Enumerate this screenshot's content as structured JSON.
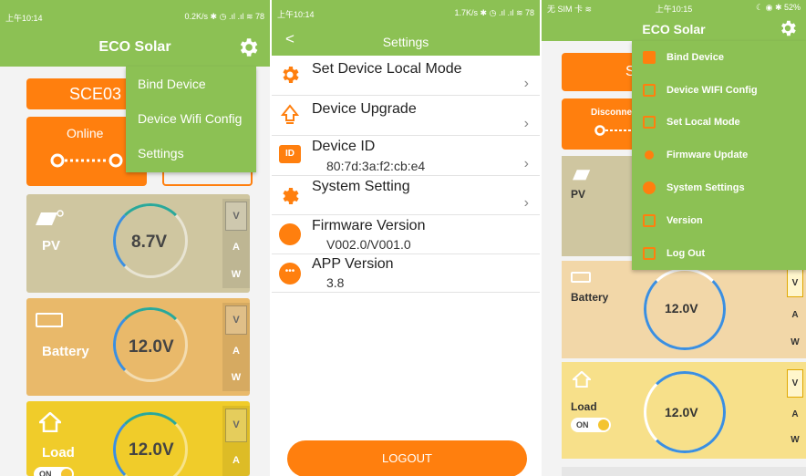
{
  "phone1": {
    "status_time": "上午10:14",
    "status_right": "0.2K/s ✱ ◷ .ıl .ıl ≋ 78",
    "title": "ECO Solar",
    "device_button": "SCE03",
    "online_label": "Online",
    "menu": [
      "Bind Device",
      "Device Wifi Config",
      "Settings"
    ],
    "cards": [
      {
        "name": "PV",
        "value": "8.7V",
        "vaw": [
          "V",
          "A",
          "W"
        ]
      },
      {
        "name": "Battery",
        "value": "12.0V",
        "vaw": [
          "V",
          "A",
          "W"
        ]
      },
      {
        "name": "Load",
        "value": "12.0V",
        "vaw": [
          "V",
          "A"
        ],
        "toggle": "ON"
      }
    ]
  },
  "phone2": {
    "status_time": "上午10:14",
    "status_right": "1.7K/s ✱ ◷ .ıl .ıl ≋ 78",
    "title": "Settings",
    "back_label": "<",
    "rows": [
      {
        "title": "Set Device Local Mode",
        "sub": ""
      },
      {
        "title": "Device Upgrade",
        "sub": ""
      },
      {
        "title": "Device ID",
        "sub": "80:7d:3a:f2:cb:e4"
      },
      {
        "title": "System Setting",
        "sub": ""
      },
      {
        "title": "Firmware Version",
        "sub": "V002.0/V001.0"
      },
      {
        "title": "APP Version",
        "sub": "3.8"
      }
    ],
    "device_id_badge": "ID",
    "logout": "LOGOUT"
  },
  "phone3": {
    "status_left": "无 SIM 卡 ≋",
    "status_time": "上午10:15",
    "status_right": "☾ ◉ ✱ 52%",
    "title": "ECO Solar",
    "device_button_partial": "S",
    "disconnect_partial": "Disconne",
    "menu": [
      "Bind Device",
      "Device WIFI Config",
      "Set Local Mode",
      "Firmware Update",
      "System Settings",
      "Version",
      "Log Out"
    ],
    "cards": [
      {
        "name": "PV",
        "value": "",
        "vaw": []
      },
      {
        "name": "Battery",
        "value": "12.0V",
        "vaw": [
          "V",
          "A",
          "W"
        ]
      },
      {
        "name": "Load",
        "value": "12.0V",
        "vaw": [
          "V",
          "A",
          "W"
        ],
        "toggle": "ON"
      }
    ]
  },
  "colors": {
    "green": "#8cc154",
    "orange": "#ff7f0e",
    "pv_card": "#cfc6a0",
    "battery_card": "#e9b96a",
    "load_card": "#f0cc2a",
    "ring_teal": "#2aa89a",
    "ring_blue": "#3b8fe0"
  }
}
